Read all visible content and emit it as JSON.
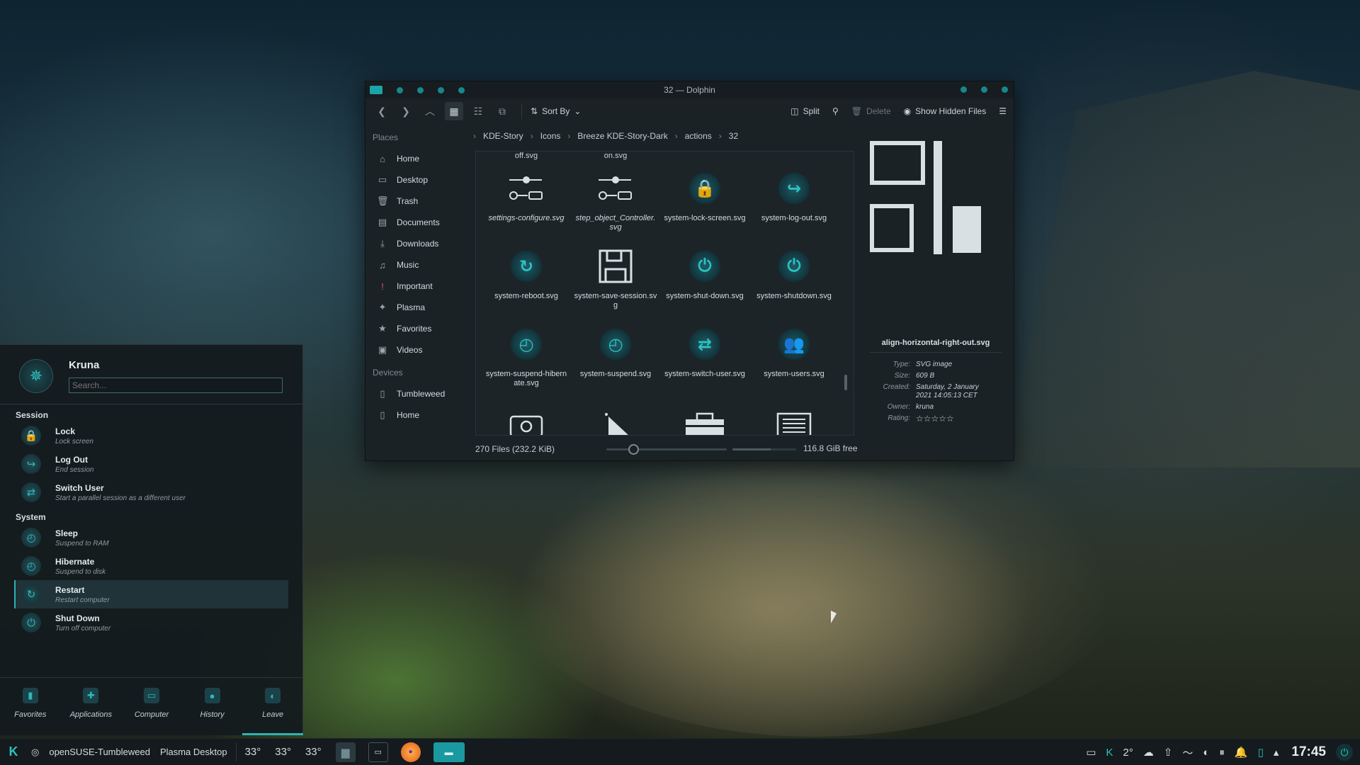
{
  "window": {
    "title": "32 — Dolphin",
    "sort_label": "Sort By",
    "split_label": "Split",
    "delete_label": "Delete",
    "hidden_files_label": "Show Hidden Files"
  },
  "sidebar": {
    "places_heading": "Places",
    "places": [
      {
        "label": "Home",
        "icon": "home-icon"
      },
      {
        "label": "Desktop",
        "icon": "desktop-icon"
      },
      {
        "label": "Trash",
        "icon": "trash-icon"
      },
      {
        "label": "Documents",
        "icon": "documents-icon"
      },
      {
        "label": "Downloads",
        "icon": "downloads-icon"
      },
      {
        "label": "Music",
        "icon": "music-icon"
      },
      {
        "label": "Important",
        "icon": "important-icon"
      },
      {
        "label": "Plasma",
        "icon": "plasma-icon"
      },
      {
        "label": "Favorites",
        "icon": "star-icon"
      },
      {
        "label": "Videos",
        "icon": "videos-icon"
      }
    ],
    "devices_heading": "Devices",
    "devices": [
      {
        "label": "Tumbleweed",
        "icon": "drive-icon"
      },
      {
        "label": "Home",
        "icon": "drive-icon"
      }
    ]
  },
  "breadcrumb": [
    "KDE-Story",
    "Icons",
    "Breeze KDE-Story-Dark",
    "actions",
    "32"
  ],
  "files": {
    "top_partial": [
      "off.svg",
      "on.svg"
    ],
    "items": [
      {
        "name": "settings-configure.svg",
        "icon": "slider-toggle-icon"
      },
      {
        "name": "step_object_Controller.svg",
        "icon": "slider-toggle-icon"
      },
      {
        "name": "system-lock-screen.svg",
        "icon": "lock-icon"
      },
      {
        "name": "system-log-out.svg",
        "icon": "log-out-icon"
      },
      {
        "name": "system-reboot.svg",
        "icon": "reboot-icon"
      },
      {
        "name": "system-save-session.svg",
        "icon": "floppy-icon"
      },
      {
        "name": "system-shut-down.svg",
        "icon": "power-icon"
      },
      {
        "name": "system-shutdown.svg",
        "icon": "power-icon"
      },
      {
        "name": "system-suspend-hibernate.svg",
        "icon": "suspend-icon"
      },
      {
        "name": "system-suspend.svg",
        "icon": "suspend-icon"
      },
      {
        "name": "system-switch-user.svg",
        "icon": "switch-user-icon"
      },
      {
        "name": "system-users.svg",
        "icon": "users-icon"
      }
    ]
  },
  "info_panel": {
    "file_name": "align-horizontal-right-out.svg",
    "type_label": "Type:",
    "type": "SVG image",
    "size_label": "Size:",
    "size": "609 B",
    "created_label": "Created:",
    "created": "Saturday, 2 January 2021 14:05:13 CET",
    "owner_label": "Owner:",
    "owner": "kruna",
    "rating_label": "Rating:",
    "rating": "☆☆☆☆☆"
  },
  "status": {
    "files": "270 Files (232.2 KiB)",
    "free": "116.8 GiB free",
    "zoom_fraction": 0.2,
    "used_fraction": 0.6
  },
  "launcher": {
    "user": "Kruna",
    "search_placeholder": "Search...",
    "session_heading": "Session",
    "session": [
      {
        "title": "Lock",
        "subtitle": "Lock screen"
      },
      {
        "title": "Log Out",
        "subtitle": "End session"
      },
      {
        "title": "Switch User",
        "subtitle": "Start a parallel session as a different user"
      }
    ],
    "system_heading": "System",
    "system": [
      {
        "title": "Sleep",
        "subtitle": "Suspend to RAM"
      },
      {
        "title": "Hibernate",
        "subtitle": "Suspend to disk"
      },
      {
        "title": "Restart",
        "subtitle": "Restart computer"
      },
      {
        "title": "Shut Down",
        "subtitle": "Turn off computer"
      }
    ],
    "tabs": [
      "Favorites",
      "Applications",
      "Computer",
      "History",
      "Leave"
    ]
  },
  "taskbar": {
    "distro": "openSUSE-Tumbleweed",
    "desktop": "Plasma Desktop",
    "temps": [
      "33°",
      "33°",
      "33°"
    ],
    "weather": "2°",
    "clock": "17:45"
  },
  "colors": {
    "accent": "#2bb3b4",
    "window_bg": "#1b2226",
    "panel_bg": "#141a1d"
  }
}
